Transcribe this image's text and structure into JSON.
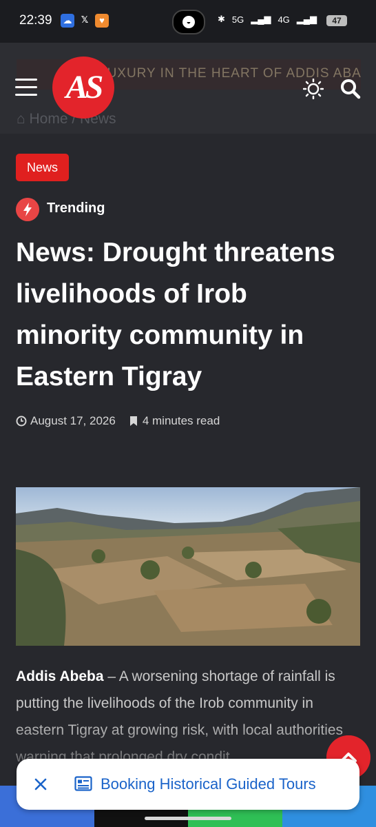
{
  "status_bar": {
    "time": "22:39",
    "apps": [
      "cloud-app-icon",
      "x-icon",
      "orange-app-icon"
    ],
    "x_glyph": "𝕏",
    "network_5g": "5G",
    "network_4g": "4G",
    "battery": "47"
  },
  "header": {
    "ad_text": "LUXURY IN THE HEART OF ADDIS ABABA",
    "breadcrumb": "⌂ Home / News",
    "logo_text": "AS"
  },
  "article": {
    "category_badge": "News",
    "trending_label": "Trending",
    "title": "News: Drought threatens livelihoods of Irob minority community in Eastern Tigray",
    "date": "August 17, 2026",
    "read_time": "4 minutes read",
    "body_lead": "Addis Abeba",
    "body_text": " – A worsening shortage of rainfall is putting the livelihoods of the Irob community in eastern Tigray at growing risk, with local authorities warning that prolonged dry condit"
  },
  "notification": {
    "label": "Booking Historical Guided Tours"
  },
  "colors": {
    "accent": "#e3242b",
    "background": "#27282d",
    "link": "#1a63c9",
    "share_colors": [
      "#3b6fd8",
      "#111111",
      "#2fbf55",
      "#2f8fe0"
    ]
  }
}
